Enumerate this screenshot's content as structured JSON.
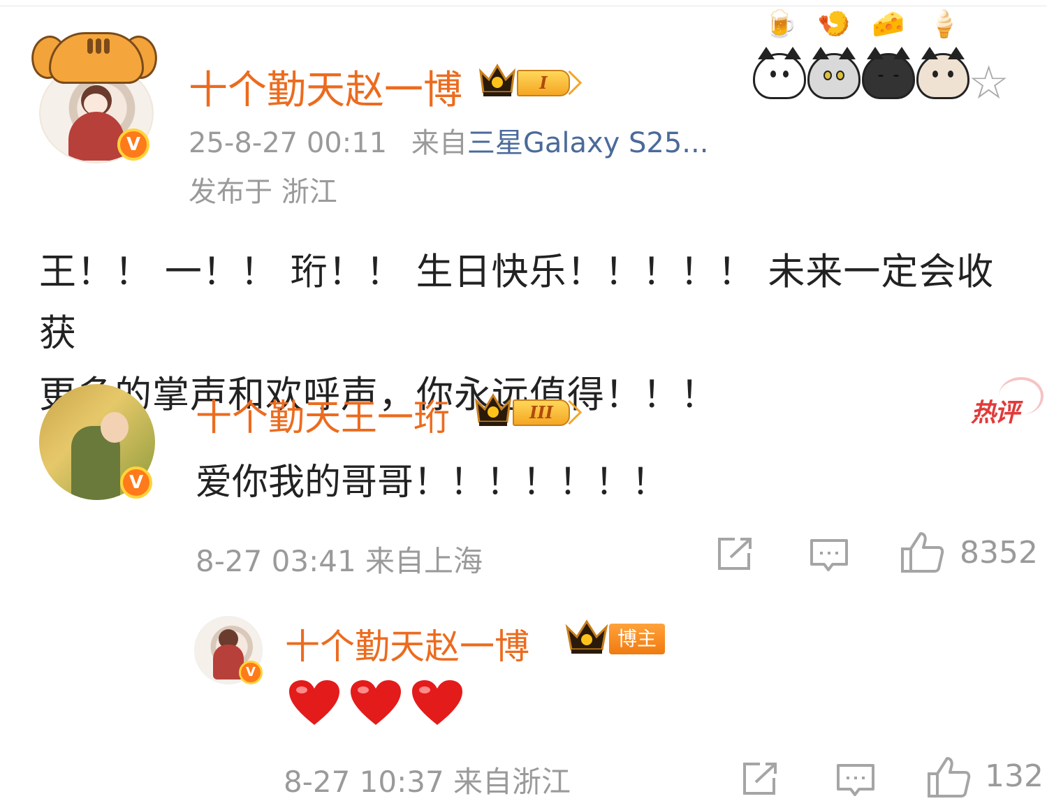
{
  "post": {
    "author": "十个勤天赵一博",
    "rank": "I",
    "time": "25-8-27 00:11",
    "from_prefix": "来自",
    "device": "三星Galaxy S25...",
    "location": "发布于 浙江",
    "body_line1": "王！！ 一！！ 珩！！ 生日快乐！！！！！ 未来一定会收获",
    "body_line2": "更多的掌声和欢呼声，你永远值得！！！"
  },
  "stickers": {
    "food": [
      "🍺",
      "🍤",
      "🧀",
      "🍦"
    ]
  },
  "hot_comment": {
    "author": "十个勤天王一珩",
    "rank": "III",
    "hot_label": "热评",
    "text": "爱你我的哥哥！！！！！！！",
    "meta": "8-27 03:41 来自上海",
    "likes": "8352"
  },
  "reply": {
    "author": "十个勤天赵一博",
    "host_label": "博主",
    "hearts": "❤❤❤",
    "meta": "8-27 10:37 来自浙江",
    "likes": "132"
  },
  "colors": {
    "name_orange": "#ec6b1e",
    "verified_badge": "#ff7a1a",
    "device_link": "#4a6a9a",
    "hot_red": "#e23a3a",
    "heart_red": "#e41b1b"
  }
}
